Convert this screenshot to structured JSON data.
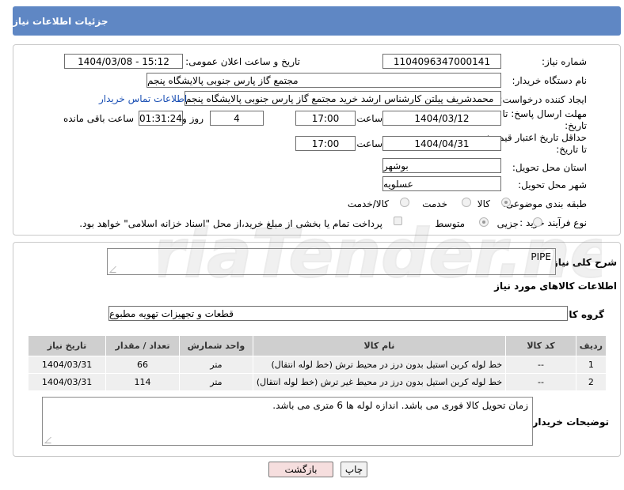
{
  "header": {
    "title": "جزئیات اطلاعات نیاز"
  },
  "form": {
    "need_number_label": "شماره نیاز:",
    "need_number": "1104096347000141",
    "announce_label": "تاریخ و ساعت اعلان عمومی:",
    "announce_value": "1404/03/08 - 15:12",
    "buyer_org_label": "نام دستگاه خریدار:",
    "buyer_org": "مجتمع گاز پارس جنوبی  پالایشگاه پنجم",
    "creator_label": "ایجاد کننده درخواست:",
    "creator": "محمدشریف پیلتن کارشناس ارشد خرید مجتمع گاز پارس جنوبی  پالایشگاه پنجم",
    "contact_link": "اطلاعات تماس خریدار",
    "deadline_label_1": "مهلت ارسال پاسخ: تا",
    "deadline_label_2": "تاریخ:",
    "deadline_date": "1404/03/12",
    "time_label": "ساعت",
    "deadline_time": "17:00",
    "days_value": "4",
    "days_label": "روز و",
    "remaining_value": "01:31:24",
    "remaining_label": "ساعت باقی مانده",
    "validity_label_1": "حداقل تاریخ اعتبار قیمت:",
    "validity_label_2": "تا تاریخ:",
    "validity_date": "1404/04/31",
    "validity_time": "17:00",
    "province_label": "استان محل تحویل:",
    "province": "بوشهر",
    "city_label": "شهر محل تحویل:",
    "city": "عسلویه",
    "category_label": "طبقه بندی موضوعی:",
    "category_options": [
      "کالا",
      "خدمت",
      "کالا/خدمت"
    ],
    "process_label": "نوع فرآیند خرید :",
    "process_options": [
      "جزیی",
      "متوسط"
    ],
    "payment_note": "پرداخت تمام یا بخشی از مبلغ خرید،از محل \"اسناد خزانه اسلامی\" خواهد بود."
  },
  "details": {
    "summary_label": "شرح کلی نیاز:",
    "summary_value": "PIPE",
    "items_title": "اطلاعات کالاهای مورد نیاز",
    "group_label": "گروه کالا:",
    "group_value": "قطعات و تجهیزات تهویه مطبوع",
    "columns": [
      "ردیف",
      "کد کالا",
      "نام کالا",
      "واحد شمارش",
      "تعداد / مقدار",
      "تاریخ نیاز"
    ],
    "rows": [
      {
        "row": "1",
        "code": "--",
        "name": "خط لوله کربن استیل بدون درز در محیط ترش (خط لوله انتقال)",
        "unit": "متر",
        "qty": "66",
        "date": "1404/03/31"
      },
      {
        "row": "2",
        "code": "--",
        "name": "خط لوله کربن استیل بدون درز در محیط غیر ترش (خط لوله انتقال)",
        "unit": "متر",
        "qty": "114",
        "date": "1404/03/31"
      }
    ],
    "buyer_notes_label": "توضیحات خریدار:",
    "buyer_notes_value": "زمان تحویل کالا فوری می باشد. اندازه لوله ها 6 متری می باشد."
  },
  "buttons": {
    "print": "چاپ",
    "back": "بازگشت"
  },
  "watermark": {
    "text": "AriaTender.neT"
  }
}
